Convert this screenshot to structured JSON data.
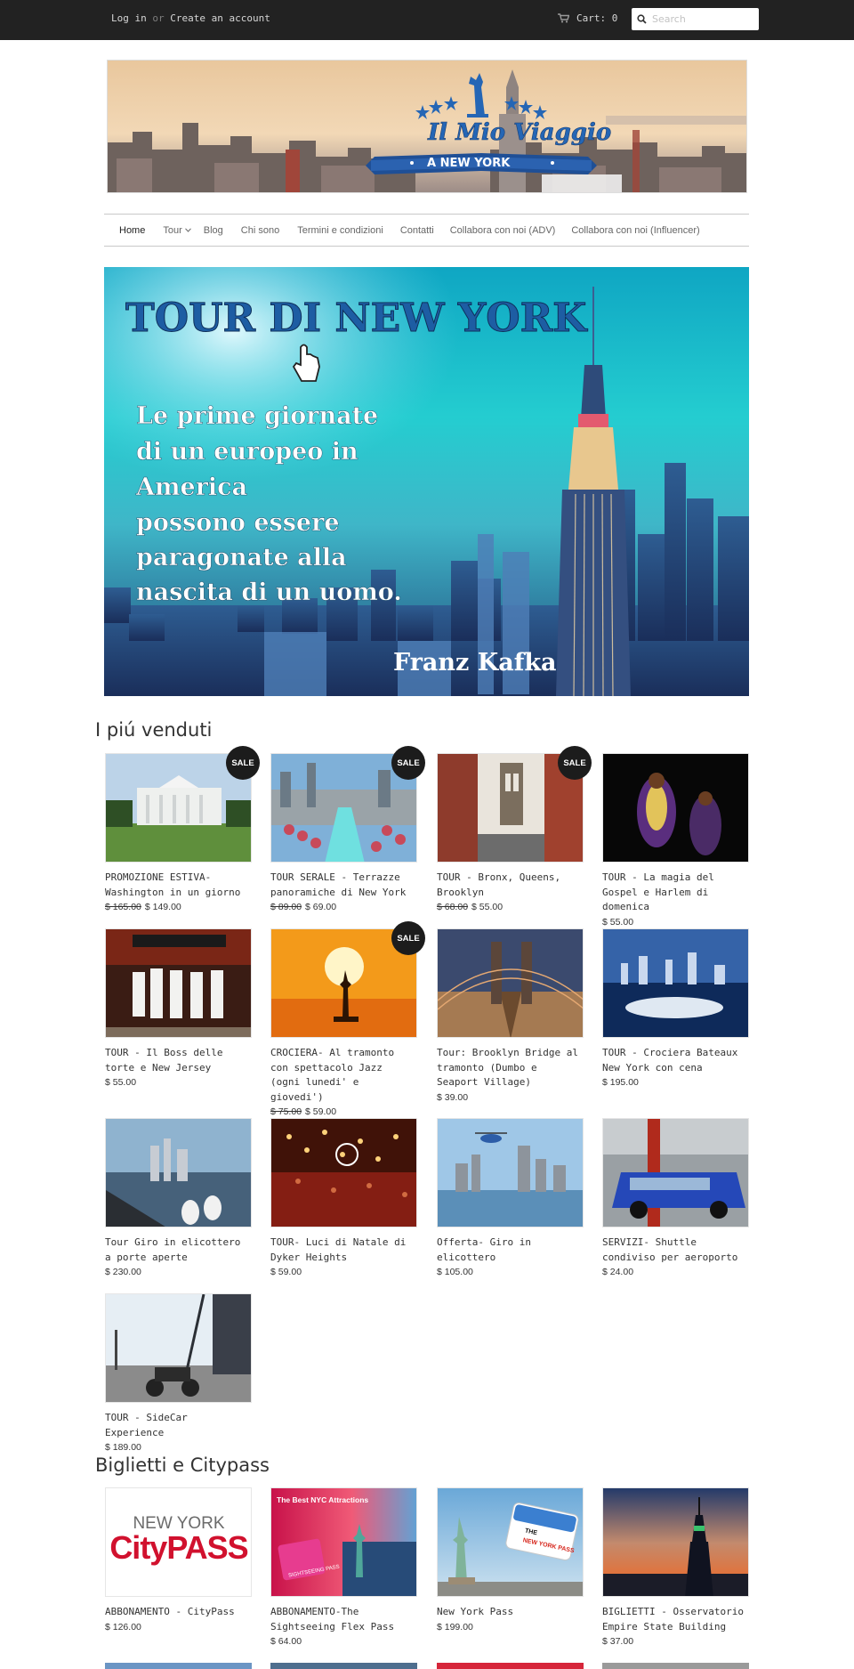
{
  "topbar": {
    "login": "Log in",
    "or": "or",
    "create_account": "Create an account",
    "cart_label": "Cart: 0",
    "search_placeholder": "Search"
  },
  "banner": {
    "title": "Il Mio Viaggio",
    "subtitle": "A NEW YORK"
  },
  "nav": {
    "items": [
      "Home",
      "Tour",
      "Blog",
      "Chi sono",
      "Termini e condizioni",
      "Contatti",
      "Collabora con noi (ADV)",
      "Collabora con noi (Influencer)"
    ]
  },
  "hero": {
    "headline": "TOUR DI NEW YORK",
    "quote_lines": [
      "Le prime giornate",
      "di un europeo in",
      "America",
      "possono essere",
      "paragonate alla",
      "nascita di un uomo."
    ],
    "author": "Franz Kafka"
  },
  "bestsellers": {
    "title": "I piú venduti",
    "sale_label": "SALE",
    "products": [
      {
        "title": "PROMOZIONE ESTIVA- Washington in un giorno",
        "old_price": "$ 165.00",
        "price": "$ 149.00",
        "sale": true
      },
      {
        "title": "TOUR SERALE - Terrazze panoramiche di New York",
        "old_price": "$ 89.00",
        "price": "$ 69.00",
        "sale": true
      },
      {
        "title": "TOUR - Bronx, Queens, Brooklyn",
        "old_price": "$ 68.00",
        "price": "$ 55.00",
        "sale": true
      },
      {
        "title": "TOUR - La magia del Gospel e Harlem di domenica",
        "old_price": "",
        "price": "$ 55.00",
        "sale": false
      },
      {
        "title": "TOUR - Il Boss delle torte e New Jersey",
        "old_price": "",
        "price": "$ 55.00",
        "sale": false
      },
      {
        "title": "CROCIERA- Al tramonto con spettacolo Jazz (ogni lunedi' e giovedi')",
        "old_price": "$ 75.00",
        "price": "$ 59.00",
        "sale": true
      },
      {
        "title": "Tour: Brooklyn Bridge al tramonto (Dumbo e Seaport Village)",
        "old_price": "",
        "price": "$ 39.00",
        "sale": false
      },
      {
        "title": "TOUR - Crociera Bateaux New York con cena",
        "old_price": "",
        "price": "$ 195.00",
        "sale": false
      },
      {
        "title": "Tour Giro in elicottero a porte aperte",
        "old_price": "",
        "price": "$ 230.00",
        "sale": false
      },
      {
        "title": "TOUR- Luci di Natale di Dyker Heights",
        "old_price": "",
        "price": "$ 59.00",
        "sale": false
      },
      {
        "title": "Offerta- Giro in elicottero",
        "old_price": "",
        "price": "$ 105.00",
        "sale": false
      },
      {
        "title": "SERVIZI- Shuttle condiviso per aeroporto",
        "old_price": "",
        "price": "$ 24.00",
        "sale": false
      },
      {
        "title": "TOUR - SideCar Experience",
        "old_price": "",
        "price": "$ 189.00",
        "sale": false
      }
    ]
  },
  "tickets": {
    "title": "Biglietti e Citypass",
    "products": [
      {
        "title": "ABBONAMENTO - CityPass",
        "price": "$ 126.00",
        "img_top": "NEW YORK",
        "img_brand": "CityPASS"
      },
      {
        "title": "ABBONAMENTO-The Sightseeing Flex Pass",
        "price": "$ 64.00",
        "img_top": "The Best NYC Attractions",
        "img_brand": "SIGHTSEEING PASS"
      },
      {
        "title": "New York Pass",
        "price": "$ 199.00",
        "img_top": "THE",
        "img_brand": "NEW YORK PASS"
      },
      {
        "title": "BIGLIETTI - Osservatorio Empire State Building",
        "price": "$ 37.00",
        "img_top": "",
        "img_brand": ""
      }
    ]
  },
  "colors": {
    "topbar": "#222222",
    "sale_badge": "#1c1c1c",
    "hero_sky": "#1fc7c7",
    "banner_blue": "#1f5fa8"
  }
}
